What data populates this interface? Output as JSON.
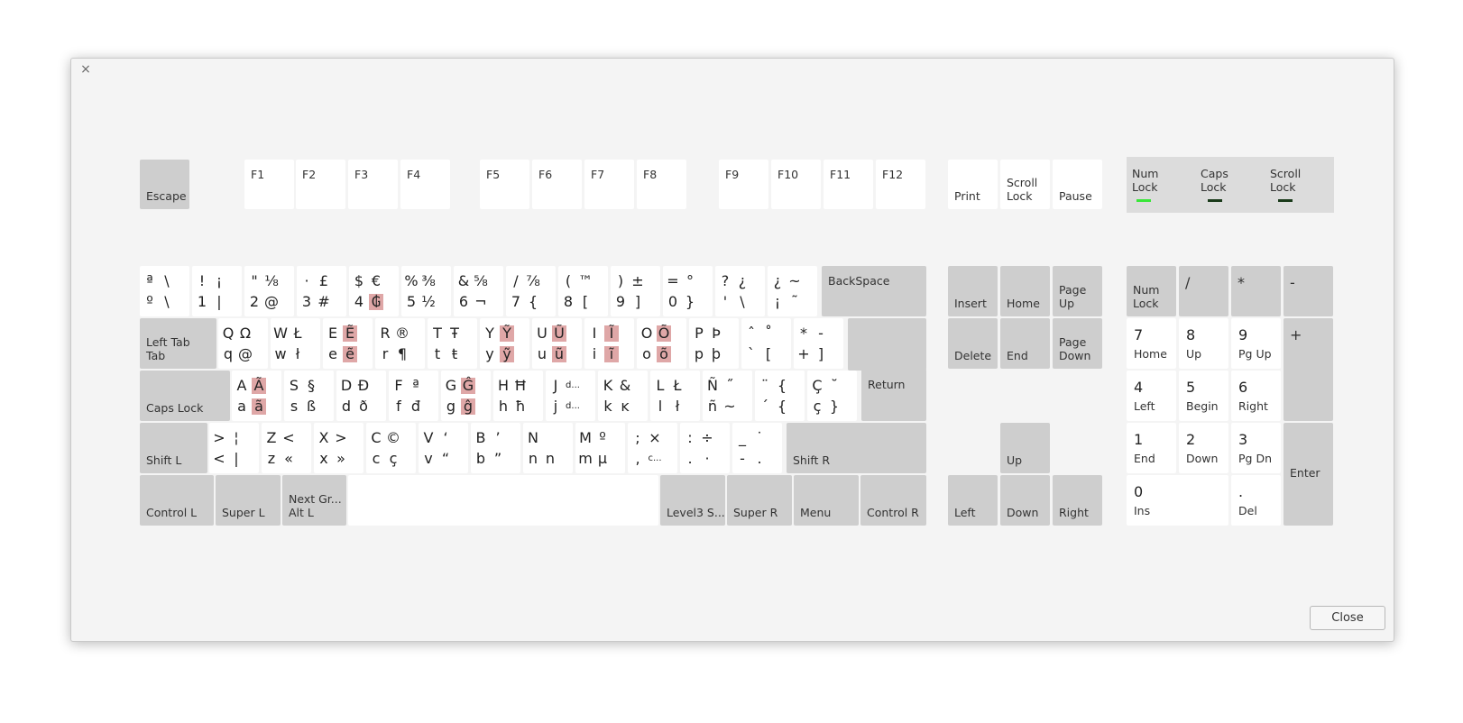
{
  "window": {
    "close_icon": "×",
    "close_button": "Close"
  },
  "indicators": {
    "num_lock": {
      "label": "Num\nLock",
      "on": true
    },
    "caps_lock": {
      "label": "Caps\nLock",
      "on": false
    },
    "scroll_lock": {
      "label": "Scroll\nLock",
      "on": false
    }
  },
  "fkeys": {
    "escape": "Escape",
    "f1": "F1",
    "f2": "F2",
    "f3": "F3",
    "f4": "F4",
    "f5": "F5",
    "f6": "F6",
    "f7": "F7",
    "f8": "F8",
    "f9": "F9",
    "f10": "F10",
    "f11": "F11",
    "f12": "F12",
    "print": "Print",
    "scroll_lock": "Scroll\nLock",
    "pause": "Pause"
  },
  "row1": [
    {
      "tl": "ª",
      "tr": "\\",
      "bl": "º",
      "br": "\\"
    },
    {
      "tl": "!",
      "tr": "¡",
      "bl": "1",
      "br": "|"
    },
    {
      "tl": "\"",
      "tr": "⅛",
      "bl": "2",
      "br": "@"
    },
    {
      "tl": "·",
      "tr": "£",
      "bl": "3",
      "br": "#"
    },
    {
      "tl": "$",
      "tr": "€",
      "bl": "4",
      "br": "₲"
    },
    {
      "tl": "%",
      "tr": "⅜",
      "bl": "5",
      "br": "½"
    },
    {
      "tl": "&",
      "tr": "⅝",
      "bl": "6",
      "br": "¬"
    },
    {
      "tl": "/",
      "tr": "⅞",
      "bl": "7",
      "br": "{"
    },
    {
      "tl": "(",
      "tr": "™",
      "bl": "8",
      "br": "["
    },
    {
      "tl": ")",
      "tr": "±",
      "bl": "9",
      "br": "]"
    },
    {
      "tl": "=",
      "tr": "°",
      "bl": "0",
      "br": "}"
    },
    {
      "tl": "?",
      "tr": "¿",
      "bl": "'",
      "br": "\\"
    },
    {
      "tl": "¿",
      "tr": "~",
      "bl": "¡",
      "br": "˜"
    }
  ],
  "row2": [
    {
      "tl": "Q",
      "tr": "Ω",
      "bl": "q",
      "br": "@"
    },
    {
      "tl": "W",
      "tr": "Ł",
      "bl": "w",
      "br": "ł"
    },
    {
      "tl": "E",
      "tr": "Ẽ",
      "bl": "e",
      "br": "ẽ"
    },
    {
      "tl": "R",
      "tr": "®",
      "bl": "r",
      "br": "¶"
    },
    {
      "tl": "T",
      "tr": "Ŧ",
      "bl": "t",
      "br": "ŧ"
    },
    {
      "tl": "Y",
      "tr": "Ỹ",
      "bl": "y",
      "br": "ỹ"
    },
    {
      "tl": "U",
      "tr": "Ũ",
      "bl": "u",
      "br": "ũ"
    },
    {
      "tl": "I",
      "tr": "Ĩ",
      "bl": "i",
      "br": "ĩ"
    },
    {
      "tl": "O",
      "tr": "Õ",
      "bl": "o",
      "br": "õ"
    },
    {
      "tl": "P",
      "tr": "Þ",
      "bl": "p",
      "br": "þ"
    },
    {
      "tl": "ˆ",
      "tr": "˚",
      "bl": "`",
      "br": "["
    },
    {
      "tl": "*",
      "tr": "-",
      "bl": "+",
      "br": "]"
    }
  ],
  "row3": [
    {
      "tl": "A",
      "tr": "Ã",
      "bl": "a",
      "br": "ã"
    },
    {
      "tl": "S",
      "tr": "§",
      "bl": "s",
      "br": "ß"
    },
    {
      "tl": "D",
      "tr": "Đ",
      "bl": "d",
      "br": "ð"
    },
    {
      "tl": "F",
      "tr": "ª",
      "bl": "f",
      "br": "đ"
    },
    {
      "tl": "G",
      "tr": "Ĝ",
      "bl": "g",
      "br": "ĝ"
    },
    {
      "tl": "H",
      "tr": "Ħ",
      "bl": "h",
      "br": "ħ"
    },
    {
      "tl": "J",
      "tr": "d...",
      "bl": "j",
      "br": "d..."
    },
    {
      "tl": "K",
      "tr": "&",
      "bl": "k",
      "br": "ĸ"
    },
    {
      "tl": "L",
      "tr": "Ł",
      "bl": "l",
      "br": "ł"
    },
    {
      "tl": "Ñ",
      "tr": "˝",
      "bl": "ñ",
      "br": "~"
    },
    {
      "tl": "¨",
      "tr": "{",
      "bl": "´",
      "br": "{"
    },
    {
      "tl": "Ç",
      "tr": "˘",
      "bl": "ç",
      "br": "}"
    }
  ],
  "row4": [
    {
      "tl": ">",
      "tr": "¦",
      "bl": "<",
      "br": "|"
    },
    {
      "tl": "Z",
      "tr": "<",
      "bl": "z",
      "br": "«"
    },
    {
      "tl": "X",
      "tr": ">",
      "bl": "x",
      "br": "»"
    },
    {
      "tl": "C",
      "tr": "©",
      "bl": "c",
      "br": "ç"
    },
    {
      "tl": "V",
      "tr": "‘",
      "bl": "v",
      "br": "“"
    },
    {
      "tl": "B",
      "tr": "’",
      "bl": "b",
      "br": "”"
    },
    {
      "tl": "N",
      "tr": "",
      "bl": "n",
      "br": "n"
    },
    {
      "tl": "M",
      "tr": "º",
      "bl": "m",
      "br": "µ"
    },
    {
      "tl": ";",
      "tr": "×",
      "bl": ",",
      "br": "c..."
    },
    {
      "tl": ":",
      "tr": "÷",
      "bl": ".",
      "br": "·"
    },
    {
      "tl": "_",
      "tr": "˙",
      "bl": "-",
      "br": "."
    }
  ],
  "mods": {
    "backspace": "BackSpace",
    "left_tab": "Left Tab\nTab",
    "return": "Return",
    "caps_lock": "Caps Lock",
    "shift_l": "Shift L",
    "shift_r": "Shift R",
    "control_l": "Control L",
    "super_l": "Super L",
    "alt_l": "Next Gr...\nAlt L",
    "level3": "Level3 S...",
    "super_r": "Super R",
    "menu": "Menu",
    "control_r": "Control R"
  },
  "nav": {
    "insert": "Insert",
    "home": "Home",
    "page_up": "Page\nUp",
    "delete": "Delete",
    "end": "End",
    "page_down": "Page\nDown",
    "up": "Up",
    "left": "Left",
    "down": "Down",
    "right": "Right"
  },
  "keypad": {
    "num_lock": "Num\nLock",
    "divide": "/",
    "multiply": "*",
    "minus": "-",
    "plus": "+",
    "enter": "Enter",
    "k7": {
      "num": "7",
      "sub": "Home"
    },
    "k8": {
      "num": "8",
      "sub": "Up"
    },
    "k9": {
      "num": "9",
      "sub": "Pg Up"
    },
    "k4": {
      "num": "4",
      "sub": "Left"
    },
    "k5": {
      "num": "5",
      "sub": "Begin"
    },
    "k6": {
      "num": "6",
      "sub": "Right"
    },
    "k1": {
      "num": "1",
      "sub": "End"
    },
    "k2": {
      "num": "2",
      "sub": "Down"
    },
    "k3": {
      "num": "3",
      "sub": "Pg Dn"
    },
    "k0": {
      "num": "0",
      "sub": "Ins"
    },
    "kdot": {
      "num": ".",
      "sub": "Del"
    }
  }
}
